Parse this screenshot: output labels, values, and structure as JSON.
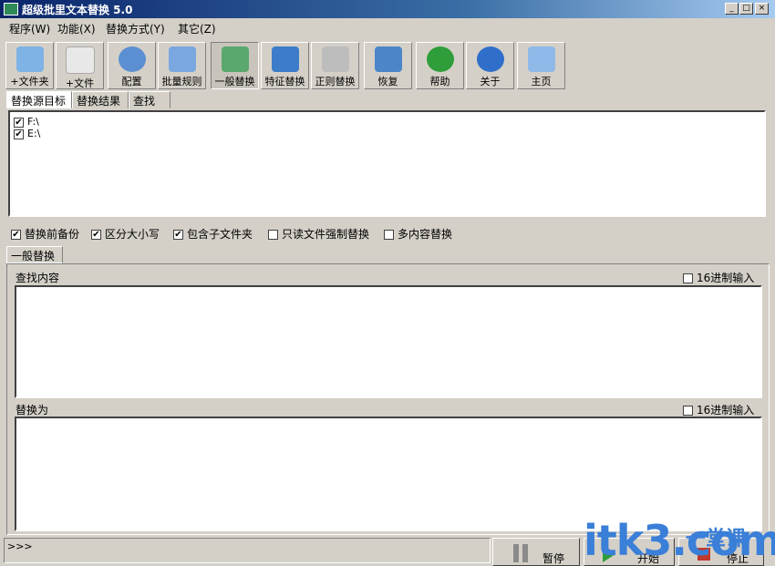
{
  "window": {
    "title": "超级批里文本替换 5.0"
  },
  "menu": [
    "程序(W)",
    "功能(X)",
    "替换方式(Y)",
    "其它(Z)"
  ],
  "toolbar": [
    {
      "label": "+文件夹",
      "icon": "folder-add-icon"
    },
    {
      "label": "+文件",
      "icon": "file-add-icon"
    },
    {
      "label": "配置",
      "icon": "gear-icon"
    },
    {
      "label": "批量规则",
      "icon": "puzzle-icon"
    },
    {
      "label": "一般替换",
      "icon": "replace-icon"
    },
    {
      "label": "特征替换",
      "icon": "network-icon"
    },
    {
      "label": "正则替换",
      "icon": "cart-icon"
    },
    {
      "label": "恢复",
      "icon": "undo-icon"
    },
    {
      "label": "帮助",
      "icon": "help-icon"
    },
    {
      "label": "关于",
      "icon": "info-icon"
    },
    {
      "label": "主页",
      "icon": "home-icon"
    }
  ],
  "top_tabs": [
    "替换源目标",
    "替换结果",
    "查找"
  ],
  "targets": [
    "F:\\",
    "E:\\"
  ],
  "options": [
    {
      "label": "替换前备份",
      "checked": true
    },
    {
      "label": "区分大小写",
      "checked": true
    },
    {
      "label": "包含子文件夹",
      "checked": true
    },
    {
      "label": "只读文件强制替换",
      "checked": false
    },
    {
      "label": "多内容替换",
      "checked": false
    }
  ],
  "mode_tab": "一般替换",
  "find": {
    "label": "查找内容",
    "hex_label": "16进制输入"
  },
  "replace": {
    "label": "替换为",
    "hex_label": "16进制输入"
  },
  "status": {
    "text": ">>>"
  },
  "buttons": {
    "pause": "暂停",
    "start": "开始",
    "stop": "停止"
  },
  "watermark": {
    "text": "itk3.com",
    "sub": "一堂课"
  }
}
